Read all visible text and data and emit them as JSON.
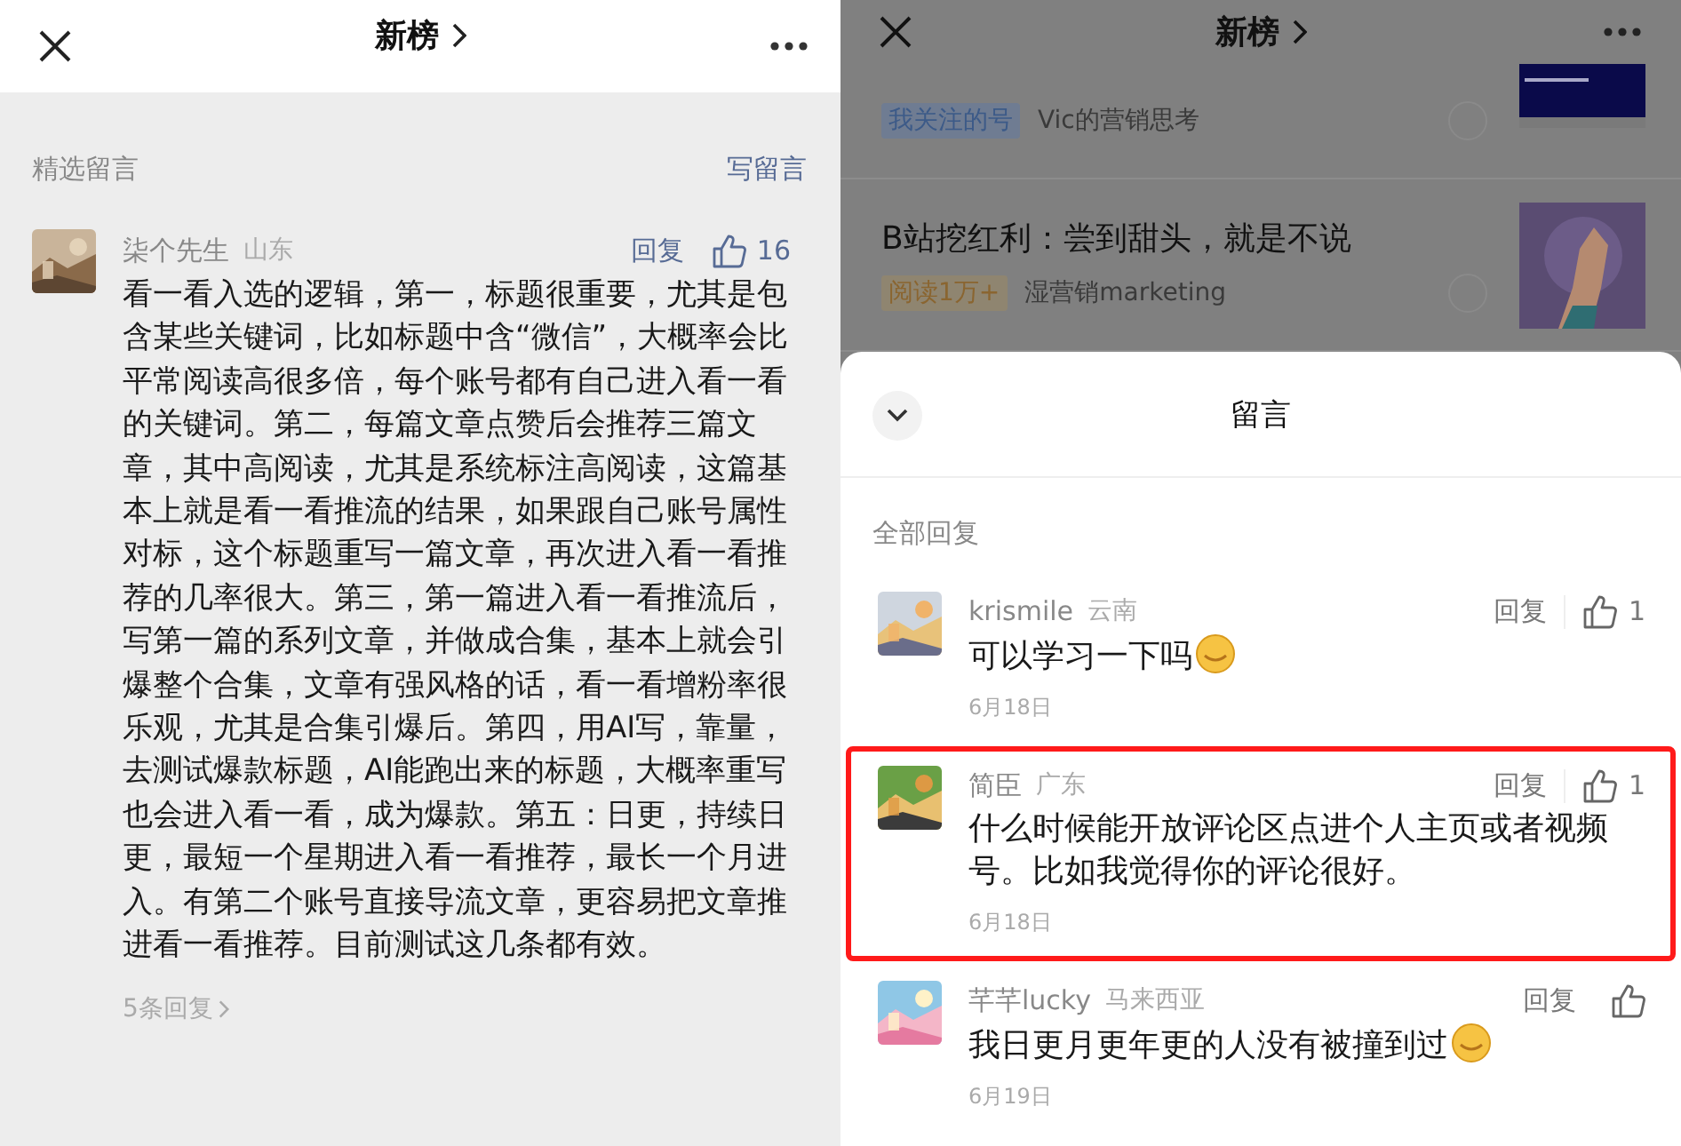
{
  "left": {
    "header": {
      "title": "新榜"
    },
    "section_title": "精选留言",
    "write_link": "写留言",
    "comment": {
      "name": "柒个先生",
      "region": "山东",
      "reply": "回复",
      "likes": "16",
      "text": "看一看入选的逻辑，第一，标题很重要，尤其是包含某些关键词，比如标题中含“微信”，大概率会比平常阅读高很多倍，每个账号都有自己进入看一看的关键词。第二，每篇文章点赞后会推荐三篇文章，其中高阅读，尤其是系统标注高阅读，这篇基本上就是看一看推流的结果，如果跟自己账号属性对标，这个标题重写一篇文章，再次进入看一看推荐的几率很大。第三，第一篇进入看一看推流后，写第一篇的系列文章，并做成合集，基本上就会引爆整个合集，文章有强风格的话，看一看增粉率很乐观，尤其是合集引爆后。第四，用AI写，靠量，去测试爆款标题，AI能跑出来的标题，大概率重写也会进入看一看，成为爆款。第五：日更，持续日更，最短一个星期进入看一看推荐，最长一个月进入。有第二个账号直接导流文章，更容易把文章推进看一看推荐。目前测试这几条都有效。",
      "replies_link": "5条回复"
    }
  },
  "right": {
    "header": {
      "title": "新榜"
    },
    "articles": [
      {
        "tag": "我关注的号",
        "kind": "followed",
        "source": "Vic的营销思考"
      },
      {
        "title": "B站挖红利：尝到甜头，就是不说",
        "tag": "阅读1万+",
        "kind": "reads",
        "source": "湿营销marketing"
      }
    ],
    "sheet": {
      "title": "留言",
      "section_title": "全部回复",
      "comments": [
        {
          "name": "krismile",
          "region": "云南",
          "text": "可以学习一下吗",
          "emoji": true,
          "reply": "回复",
          "likes": "1",
          "date": "6月18日",
          "highlighted": false
        },
        {
          "name": "简臣",
          "region": "广东",
          "text": "什么时候能开放评论区点进个人主页或者视频号。比如我觉得你的评论很好。",
          "emoji": false,
          "reply": "回复",
          "likes": "1",
          "date": "6月18日",
          "highlighted": true
        },
        {
          "name": "芊芊lucky",
          "region": "马来西亚",
          "text": "我日更月更年更的人没有被撞到过",
          "emoji": true,
          "reply": "回复",
          "date": "6月19日",
          "highlighted": false
        }
      ]
    }
  }
}
